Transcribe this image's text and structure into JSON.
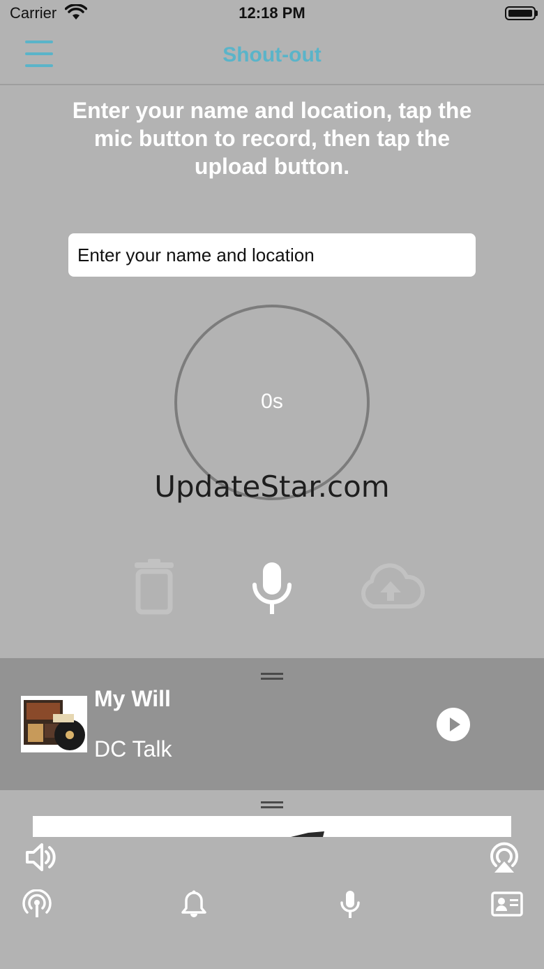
{
  "status_bar": {
    "carrier": "Carrier",
    "time": "12:18 PM"
  },
  "nav": {
    "title": "Shout-out",
    "menu_icon": "hamburger-menu-icon"
  },
  "instructions": "Enter your name and location, tap the mic button to record, then tap the upload button.",
  "name_field": {
    "placeholder": "Enter your name and location",
    "value": ""
  },
  "recorder": {
    "elapsed": "0s"
  },
  "watermark": "UpdateStar.com",
  "controls": {
    "delete_icon": "trash-icon",
    "record_icon": "microphone-icon",
    "upload_icon": "cloud-upload-icon"
  },
  "now_playing": {
    "title": "My Will",
    "artist": "DC Talk",
    "play_icon": "play-icon"
  },
  "player_bar": {
    "volume_icon": "speaker-icon",
    "airplay_icon": "airplay-icon"
  },
  "tab_bar": [
    {
      "icon": "broadcast-icon"
    },
    {
      "icon": "bell-icon"
    },
    {
      "icon": "microphone-icon"
    },
    {
      "icon": "contact-card-icon"
    }
  ],
  "colors": {
    "accent": "#5ab4c9",
    "background": "#b3b3b3",
    "now_playing_background": "#939393"
  }
}
